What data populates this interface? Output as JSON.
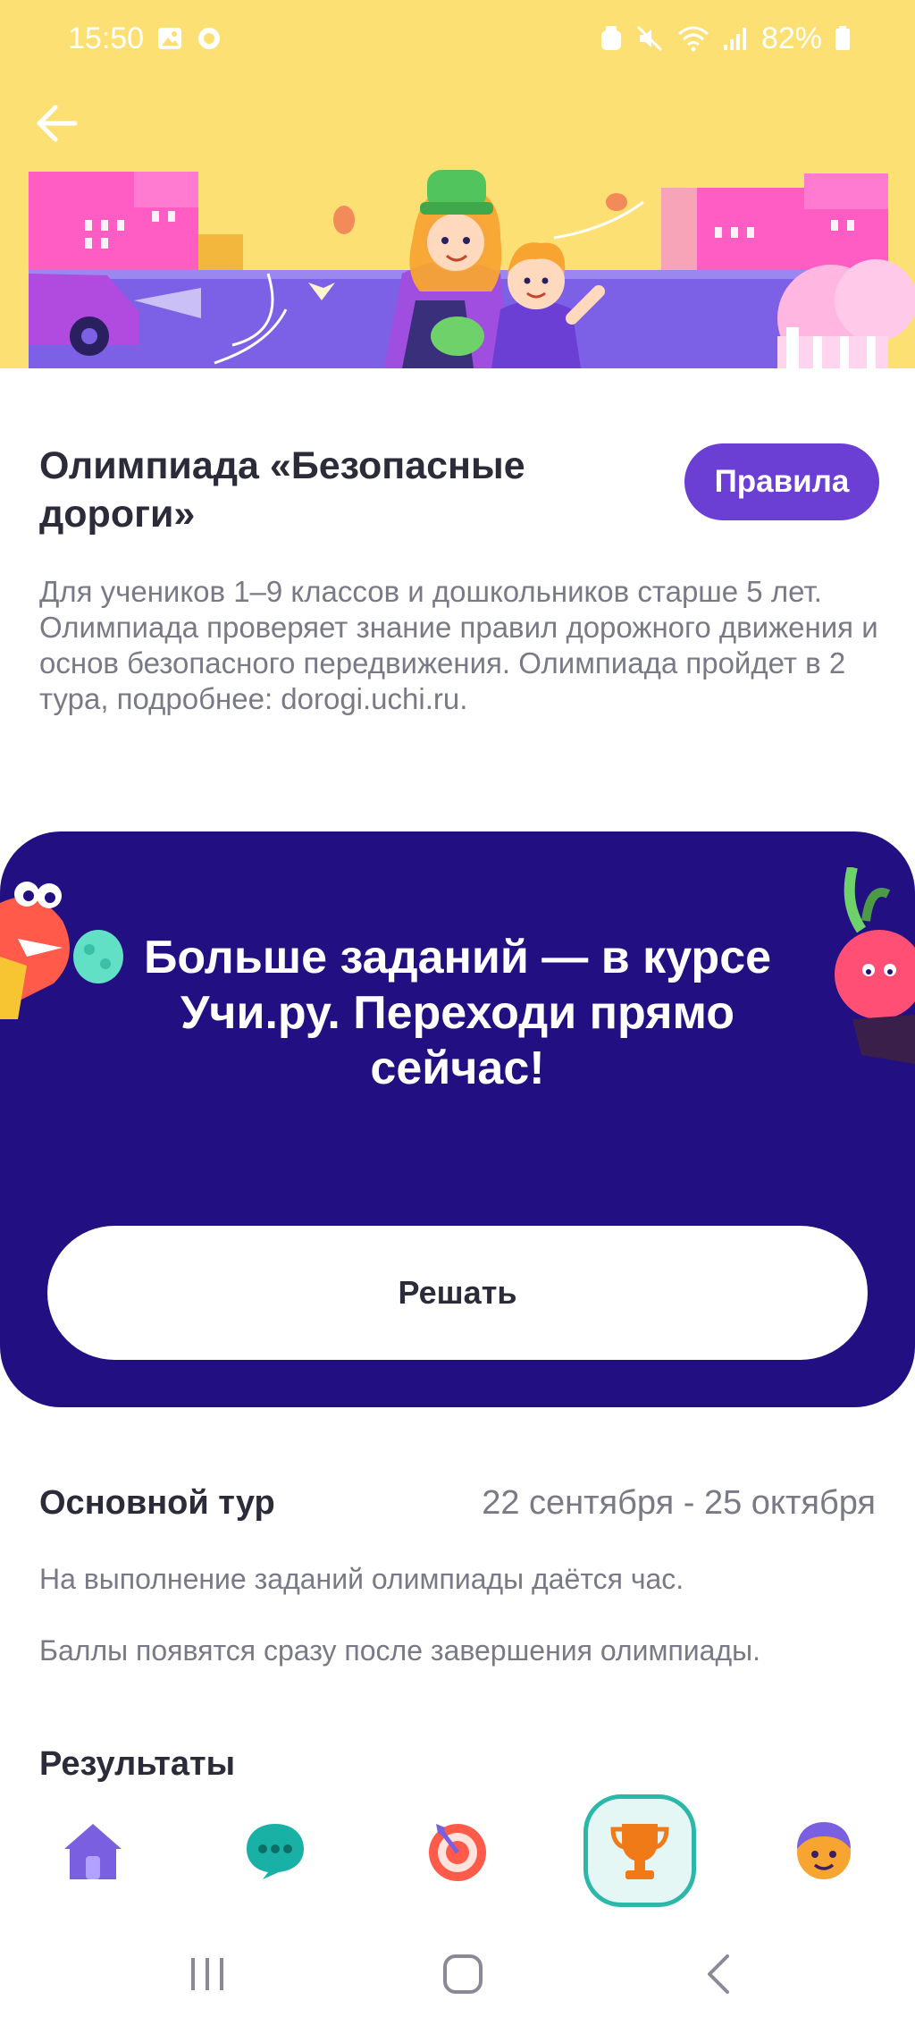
{
  "status_bar": {
    "time": "15:50",
    "battery": "82%",
    "icons": [
      "image-icon",
      "chat-bubble-icon",
      "alarm-icon",
      "mute-icon",
      "wifi-icon",
      "signal-icon",
      "battery-icon"
    ]
  },
  "header": {
    "back_icon": "arrow-left-icon",
    "banner": "road-safety-illustration"
  },
  "olympiad": {
    "title": "Олимпиада «Безопасные дороги»",
    "rules_label": "Правила",
    "description": "Для учеников 1–9 классов и дошкольников старше 5 лет. Олимпиада проверяет знание правил дорожного движения и основ безопасного передвижения. Олимпиада пройдет в 2 тура, подробнее: dorogi.uchi.ru."
  },
  "promo": {
    "title": "Больше заданий — в курсе Учи.ру. Переходи прямо сейчас!",
    "button_label": "Решать",
    "colors": {
      "background": "#220f82"
    }
  },
  "round": {
    "name": "Основной тур",
    "dates": "22 сентября - 25 октября",
    "info_1": "На выполнение заданий олимпиады даётся час.",
    "info_2": "Баллы появятся сразу после завершения олимпиады."
  },
  "results": {
    "heading": "Результаты"
  },
  "bottom_nav": {
    "items": [
      {
        "icon": "home-icon",
        "active": false
      },
      {
        "icon": "chat-icon",
        "active": false
      },
      {
        "icon": "target-icon",
        "active": false
      },
      {
        "icon": "trophy-icon",
        "active": true
      },
      {
        "icon": "profile-icon",
        "active": false
      }
    ]
  },
  "system_nav": {
    "icons": [
      "recents-icon",
      "home-button-icon",
      "back-icon"
    ]
  },
  "colors": {
    "accent": "#6b3fd4",
    "header_yellow": "#fde073",
    "active_teal": "#2bb8a8"
  }
}
